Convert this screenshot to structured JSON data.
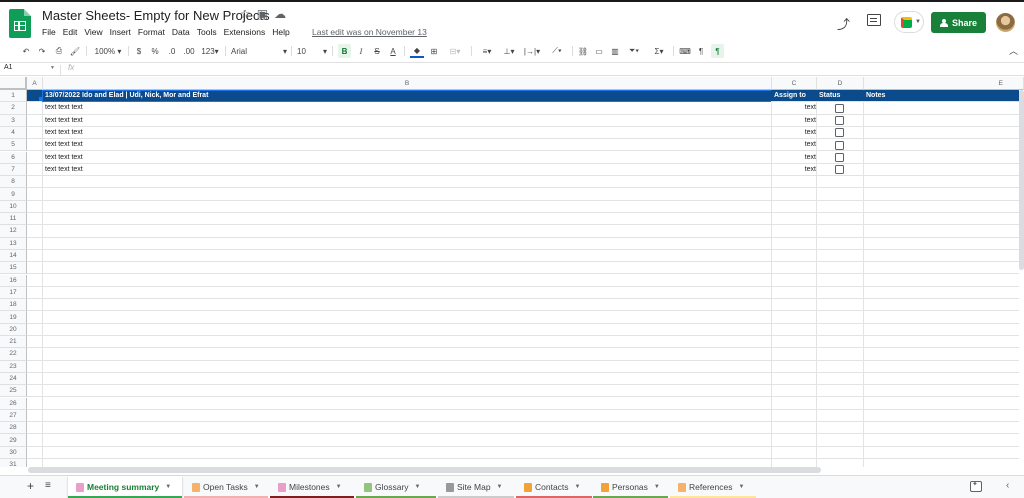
{
  "app": {
    "doc_title": "Master Sheets- Empty for New Projects",
    "menu": [
      "File",
      "Edit",
      "View",
      "Insert",
      "Format",
      "Data",
      "Tools",
      "Extensions",
      "Help"
    ],
    "last_edit": "Last edit was on November 13",
    "share_label": "Share"
  },
  "toolbar": {
    "zoom": "100%",
    "currency": "$",
    "percent": "%",
    "dec_decrease": ".0",
    "dec_increase": ".00",
    "more_formats": "123",
    "font": "Arial",
    "font_size": "10",
    "bold": "B",
    "italic": "I",
    "strike": "S",
    "text_color": "A"
  },
  "formula_bar": {
    "name_box": "A1",
    "fx": "fx"
  },
  "columns": [
    "A",
    "B",
    "C",
    "D",
    "E"
  ],
  "rows": [
    "1",
    "2",
    "3",
    "4",
    "5",
    "6",
    "7",
    "8",
    "9",
    "10",
    "11",
    "12",
    "13",
    "14",
    "15",
    "16",
    "17",
    "18",
    "19",
    "20",
    "21",
    "22",
    "23",
    "24",
    "25",
    "26",
    "27",
    "28",
    "29",
    "30",
    "31"
  ],
  "sheet_header": {
    "title": "13/07/2022  Ido and Elad | Udi, Nick, Mor and Efrat",
    "assign": "Assign to",
    "status": "Status",
    "notes": "Notes"
  },
  "data_rows": [
    {
      "text": "text text text",
      "assign": "text",
      "status": false
    },
    {
      "text": "text text text",
      "assign": "text",
      "status": false
    },
    {
      "text": "text text text",
      "assign": "text",
      "status": false
    },
    {
      "text": "text text text",
      "assign": "text",
      "status": false
    },
    {
      "text": "text text text",
      "assign": "text",
      "status": false
    },
    {
      "text": "text text text",
      "assign": "text",
      "status": false
    }
  ],
  "tabs": [
    {
      "label": "Meeting summary",
      "icon_color": "#e8a0c8",
      "underline": "#34a853",
      "active": true
    },
    {
      "label": "Open Tasks",
      "icon_color": "#f6b26b",
      "underline": "#f4b0b0",
      "active": false
    },
    {
      "label": "Milestones",
      "icon_color": "#e8a0c8",
      "underline": "#7f1f1f",
      "active": false
    },
    {
      "label": "Glossary",
      "icon_color": "#93c47d",
      "underline": "#6aa84f",
      "active": false
    },
    {
      "label": "Site Map",
      "icon_color": "#999999",
      "underline": "#cccccc",
      "active": false
    },
    {
      "label": "Contacts",
      "icon_color": "#f1a33a",
      "underline": "#e06666",
      "active": false
    },
    {
      "label": "Personas",
      "icon_color": "#f1a33a",
      "underline": "#6aa84f",
      "active": false
    },
    {
      "label": "References",
      "icon_color": "#f6b26b",
      "underline": "#ffe599",
      "active": false
    }
  ],
  "colors": {
    "header_fill": "#0b4a8b",
    "brand_green": "#188038",
    "selection": "#1a73e8"
  }
}
